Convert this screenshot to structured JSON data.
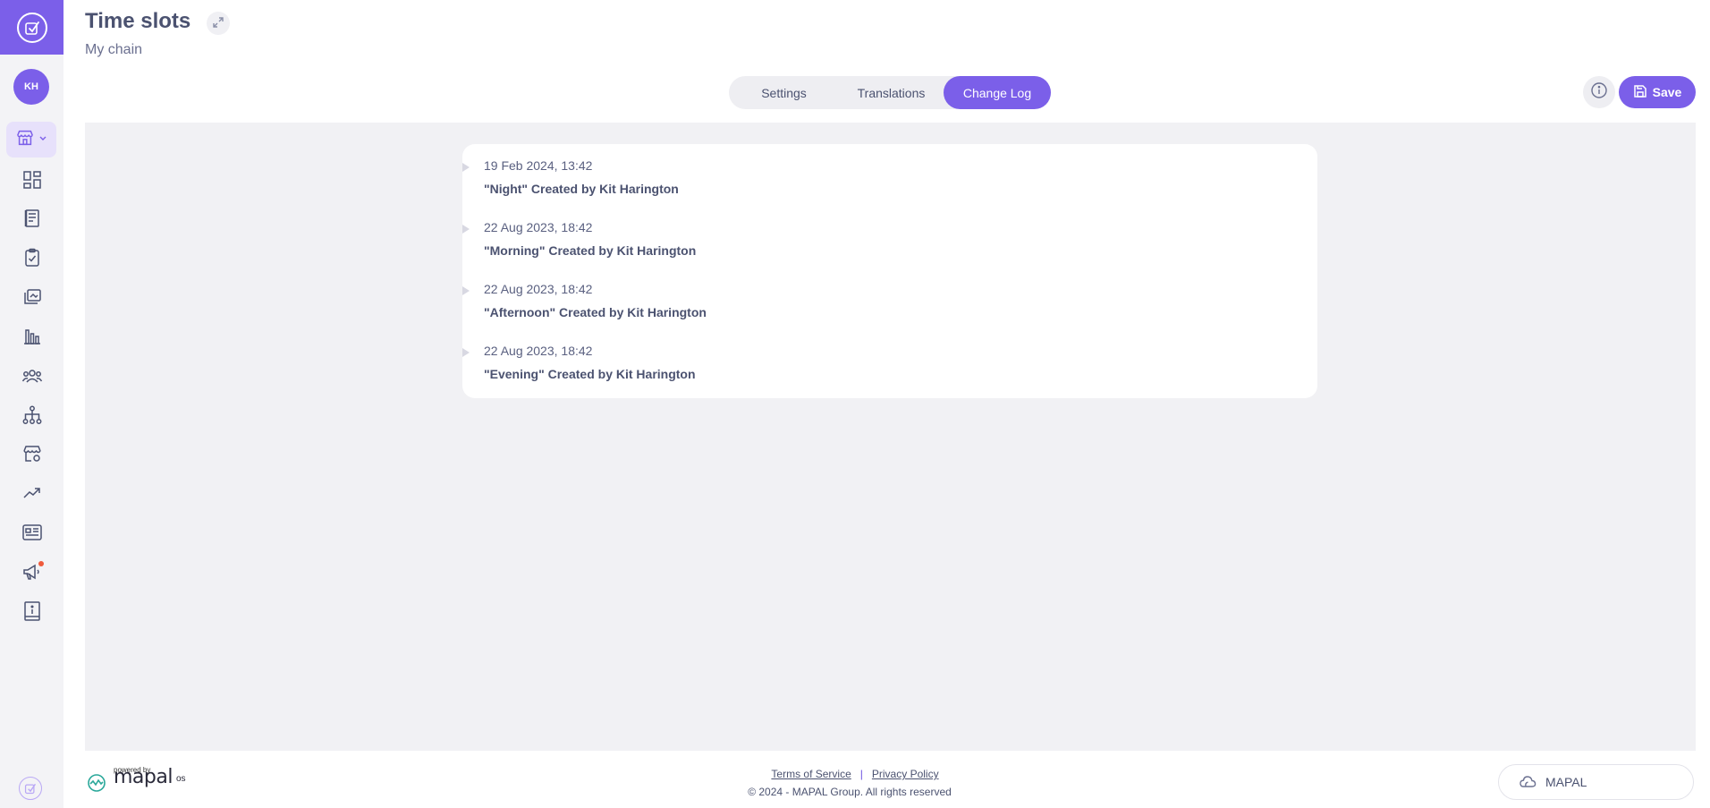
{
  "header": {
    "title": "Time slots",
    "subtitle": "My chain"
  },
  "user": {
    "initials": "KH"
  },
  "tabs": [
    {
      "label": "Settings",
      "active": false
    },
    {
      "label": "Translations",
      "active": false
    },
    {
      "label": "Change Log",
      "active": true
    }
  ],
  "toolbar": {
    "save_label": "Save"
  },
  "sidebar": {
    "items": [
      {
        "icon": "store-icon"
      },
      {
        "icon": "dashboard-icon"
      },
      {
        "icon": "book-icon"
      },
      {
        "icon": "clipboard-icon"
      },
      {
        "icon": "library-icon"
      },
      {
        "icon": "bar-chart-icon"
      },
      {
        "icon": "people-icon"
      },
      {
        "icon": "hierarchy-icon"
      },
      {
        "icon": "store-settings-icon"
      },
      {
        "icon": "trend-icon"
      },
      {
        "icon": "news-icon"
      },
      {
        "icon": "megaphone-icon"
      },
      {
        "icon": "info-book-icon"
      }
    ]
  },
  "change_log": [
    {
      "date": "19 Feb 2024, 13:42",
      "description": "\"Night\" Created by Kit Harington"
    },
    {
      "date": "22 Aug 2023, 18:42",
      "description": "\"Morning\" Created by Kit Harington"
    },
    {
      "date": "22 Aug 2023, 18:42",
      "description": "\"Afternoon\" Created by Kit Harington"
    },
    {
      "date": "22 Aug 2023, 18:42",
      "description": "\"Evening\" Created by Kit Harington"
    }
  ],
  "footer": {
    "powered_by": "powered by",
    "brand": "mapal",
    "brand_suffix": "os",
    "terms": "Terms of Service",
    "separator": "|",
    "privacy": "Privacy Policy",
    "copyright": "© 2024 - MAPAL Group. All rights reserved",
    "org_chip": "MAPAL"
  },
  "colors": {
    "accent": "#7b5fe9",
    "background": "#f1f1f4",
    "text": "#4b5270",
    "notification": "#ef5a3c"
  }
}
